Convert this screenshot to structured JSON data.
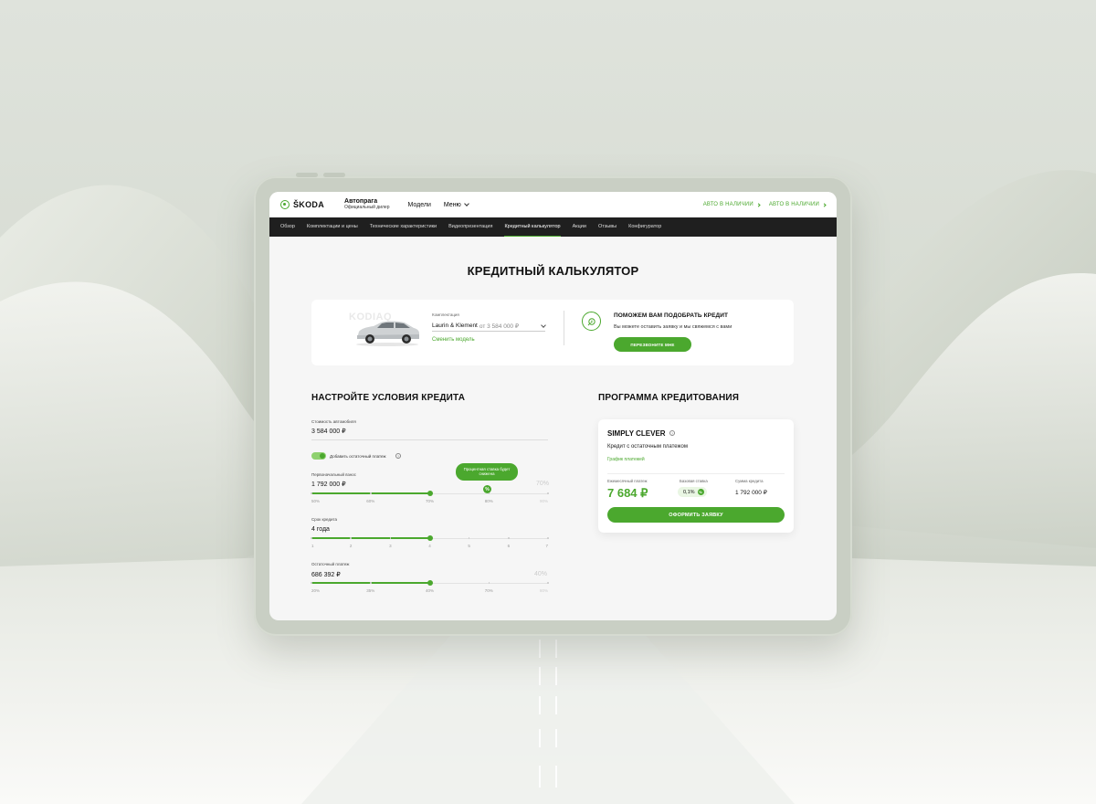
{
  "header": {
    "brand": "ŠKODA",
    "dealer_name": "Автопрага",
    "dealer_subtitle": "Официальный дилер",
    "nav_models": "Модели",
    "nav_menu": "Меню",
    "avail_links": [
      "АВТО В НАЛИЧИИ",
      "АВТО В НАЛИЧИИ"
    ]
  },
  "subnav": {
    "items": [
      "Обзор",
      "Комплектации и цены",
      "Технические характеристики",
      "Видеопрезентация",
      "Кредитный калькулятор",
      "Акции",
      "Отзывы",
      "Конфигуратор"
    ],
    "active_index": 4
  },
  "page_title": "КРЕДИТНЫЙ КАЛЬКУЛЯТОР",
  "car": {
    "model": "KODIAQ",
    "complectation_label": "Комплектация",
    "complectation_value": "Laurin & Klement",
    "complectation_price": "от 3 584 000 ₽",
    "change_model": "Сменить модель"
  },
  "help": {
    "title": "ПОМОЖЕМ ВАМ ПОДОБРАТЬ КРЕДИТ",
    "text": "Вы можете оставить заявку и мы свяжемся с вами",
    "button": "ПЕРЕЗВОНИТЕ МНЕ"
  },
  "conditions": {
    "title": "НАСТРОЙТЕ УСЛОВИЯ КРЕДИТА",
    "car_price_label": "Стоимость автомобиля",
    "car_price_value": "3 584 000 ₽",
    "residual_toggle_label": "Добавить остаточный платеж",
    "residual_toggle_on": true,
    "down_payment": {
      "label": "Первоначальный взнос",
      "value": "1 792 000 ₽",
      "max_hint": "70%",
      "ticks": [
        "50%",
        "60%",
        "70%",
        "80%",
        "90%"
      ],
      "level": 0.5
    },
    "tooltip": "Процентная ставка будет снижена",
    "rate_marker": "%",
    "term": {
      "label": "Срок кредита",
      "value": "4 года",
      "ticks": [
        "1",
        "2",
        "3",
        "4",
        "5",
        "6",
        "7"
      ],
      "level": 0.5
    },
    "residual": {
      "label": "Остаточный платеж",
      "value": "686 392 ₽",
      "max_hint": "40%",
      "ticks": [
        "20%",
        "35%",
        "40%",
        "70%",
        "80%"
      ],
      "level": 0.5
    }
  },
  "program": {
    "title": "ПРОГРАММА КРЕДИТОВАНИЯ",
    "name": "SIMPLY CLEVER",
    "description": "Кредит с остаточным платежом",
    "schedule_link": "График платежей",
    "monthly_label": "Ежемесячный платеж",
    "monthly_value": "7 684 ₽",
    "rate_label": "Базовая ставка",
    "rate_value": "0,1%",
    "sum_label": "Сумма кредита",
    "sum_value": "1 792 000 ₽",
    "apply_button": "ОФОРМИТЬ ЗАЯВКУ"
  },
  "colors": {
    "accent": "#4ba82e",
    "nav_dark": "#1f1f1f",
    "page_bg": "#f6f6f6"
  }
}
